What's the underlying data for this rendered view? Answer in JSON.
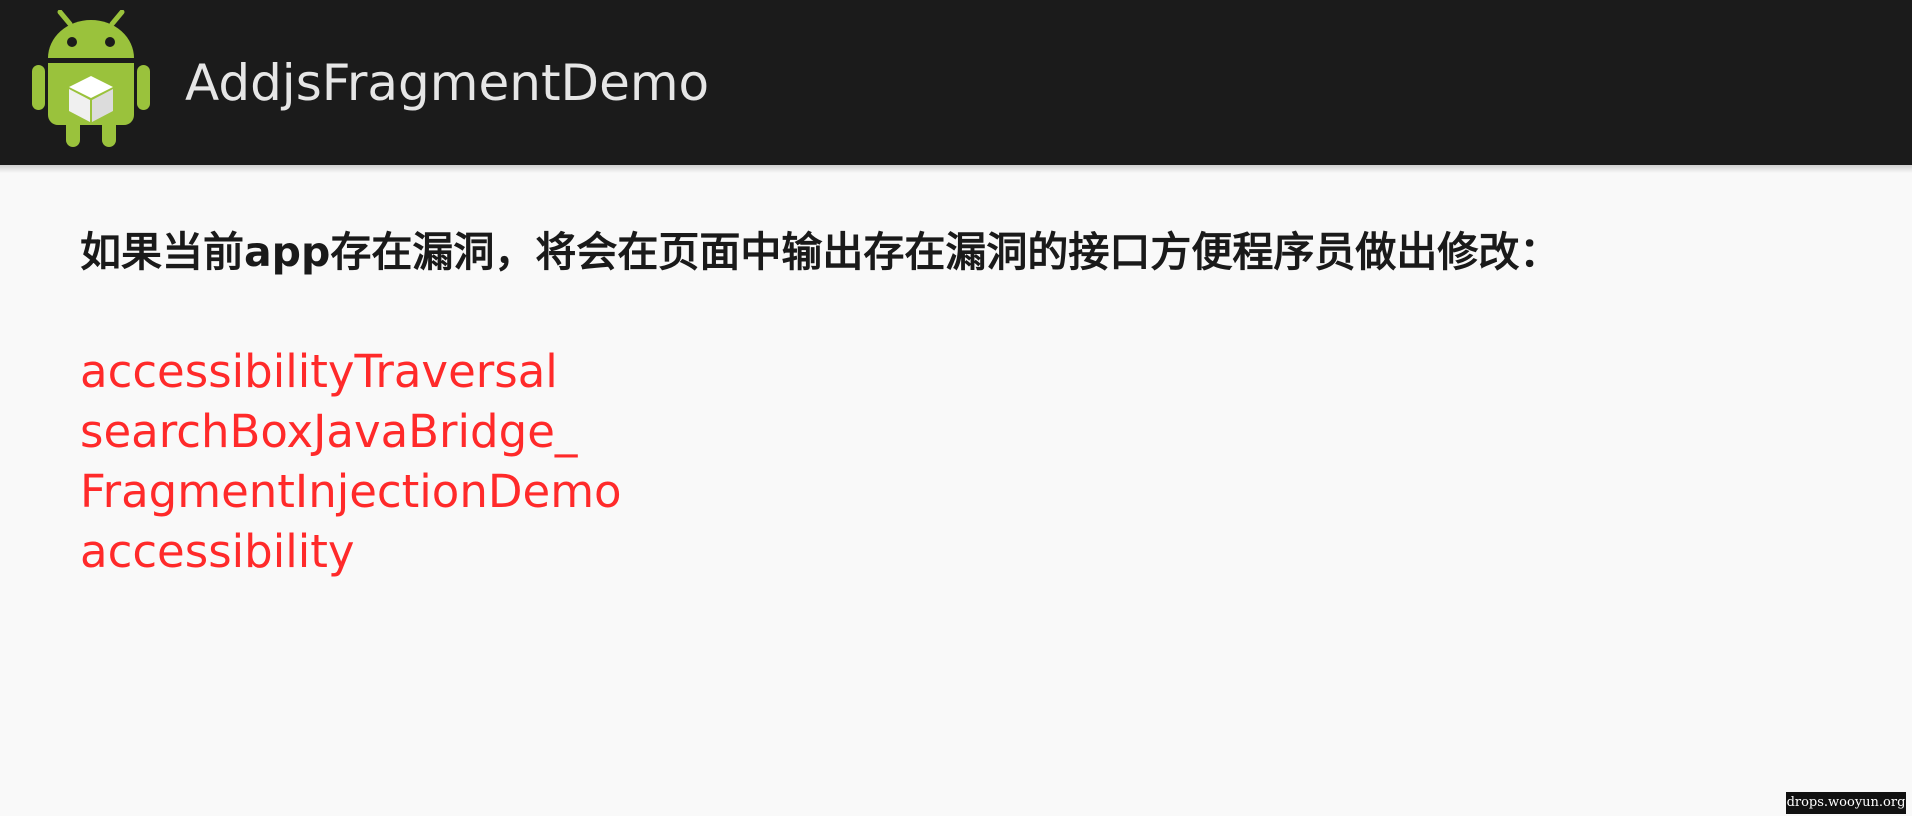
{
  "app": {
    "title": "AddjsFragmentDemo",
    "icon": "android-robot-icon",
    "icon_color": "#9ac23c"
  },
  "content": {
    "message": "如果当前app存在漏洞，将会在页面中输出存在漏洞的接口方便程序员做出修改：",
    "vulnerable_interfaces": [
      "accessibilityTraversal",
      "searchBoxJavaBridge_",
      "FragmentInjectionDemo",
      "accessibility"
    ]
  },
  "watermark": {
    "text": "drops.wooyun.org"
  },
  "colors": {
    "action_bar": "#1b1b1b",
    "title_text": "#e6e6e6",
    "body_background": "#f9f9f9",
    "message_text": "#1a1a1a",
    "vulnerable_text": "#ff2a2a"
  }
}
